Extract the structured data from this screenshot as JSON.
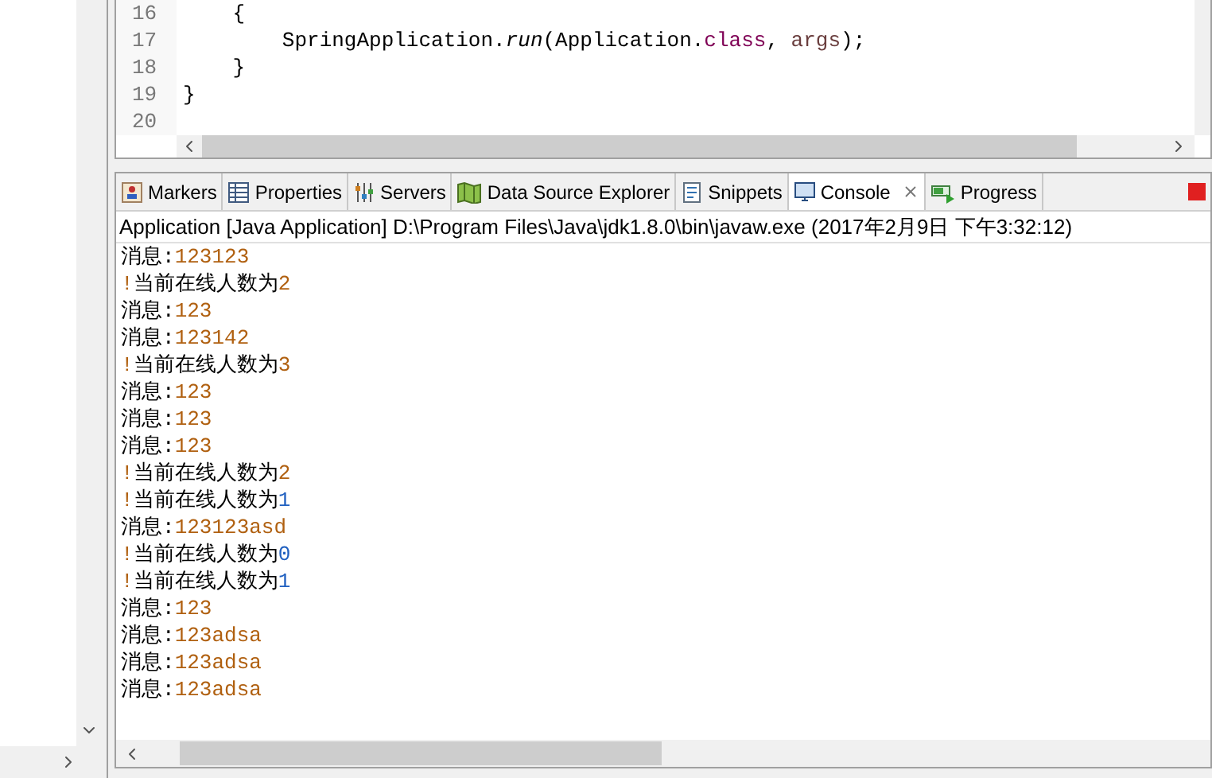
{
  "editor": {
    "lines": [
      {
        "number": "16",
        "parts": [
          {
            "kind": "plain",
            "text": "    {"
          }
        ]
      },
      {
        "number": "17",
        "parts": [
          {
            "kind": "plain",
            "text": "        SpringApplication."
          },
          {
            "kind": "method",
            "text": "run"
          },
          {
            "kind": "plain",
            "text": "(Application."
          },
          {
            "kind": "keyword",
            "text": "class"
          },
          {
            "kind": "plain",
            "text": ", "
          },
          {
            "kind": "variable",
            "text": "args"
          },
          {
            "kind": "plain",
            "text": ");"
          }
        ]
      },
      {
        "number": "18",
        "parts": [
          {
            "kind": "plain",
            "text": "    }"
          }
        ]
      },
      {
        "number": "19",
        "parts": [
          {
            "kind": "plain",
            "text": "}"
          }
        ]
      },
      {
        "number": "20"
      }
    ]
  },
  "tabs": [
    {
      "label": "Markers",
      "selected": false
    },
    {
      "label": "Properties",
      "selected": false
    },
    {
      "label": "Servers",
      "selected": false
    },
    {
      "label": "Data Source Explorer",
      "selected": false
    },
    {
      "label": "Snippets",
      "selected": false
    },
    {
      "label": "Console",
      "selected": true,
      "closable": true
    },
    {
      "label": "Progress",
      "selected": false
    }
  ],
  "console": {
    "title": "Application [Java Application] D:\\Program Files\\Java\\jdk1.8.0\\bin\\javaw.exe (2017年2月9日 下午3:32:12)",
    "lines": [
      [
        {
          "kind": "plain",
          "text": "消息:"
        },
        {
          "kind": "value",
          "text": "123123"
        }
      ],
      [
        {
          "kind": "value",
          "text": "!"
        },
        {
          "kind": "plain",
          "text": "当前在线人数为"
        },
        {
          "kind": "value",
          "text": "2"
        }
      ],
      [
        {
          "kind": "plain",
          "text": "消息:"
        },
        {
          "kind": "value",
          "text": "123"
        }
      ],
      [
        {
          "kind": "plain",
          "text": "消息:"
        },
        {
          "kind": "value",
          "text": "123142"
        }
      ],
      [
        {
          "kind": "value",
          "text": "!"
        },
        {
          "kind": "plain",
          "text": "当前在线人数为"
        },
        {
          "kind": "value",
          "text": "3"
        }
      ],
      [
        {
          "kind": "plain",
          "text": "消息:"
        },
        {
          "kind": "value",
          "text": "123"
        }
      ],
      [
        {
          "kind": "plain",
          "text": "消息:"
        },
        {
          "kind": "value",
          "text": "123"
        }
      ],
      [
        {
          "kind": "plain",
          "text": "消息:"
        },
        {
          "kind": "value",
          "text": "123"
        }
      ],
      [
        {
          "kind": "value",
          "text": "!"
        },
        {
          "kind": "plain",
          "text": "当前在线人数为"
        },
        {
          "kind": "value",
          "text": "2"
        }
      ],
      [
        {
          "kind": "value",
          "text": "!"
        },
        {
          "kind": "plain",
          "text": "当前在线人数为"
        },
        {
          "kind": "number",
          "text": "1"
        }
      ],
      [
        {
          "kind": "plain",
          "text": "消息:"
        },
        {
          "kind": "value",
          "text": "123123asd"
        }
      ],
      [
        {
          "kind": "value",
          "text": "!"
        },
        {
          "kind": "plain",
          "text": "当前在线人数为"
        },
        {
          "kind": "number",
          "text": "0"
        }
      ],
      [
        {
          "kind": "value",
          "text": "!"
        },
        {
          "kind": "plain",
          "text": "当前在线人数为"
        },
        {
          "kind": "number",
          "text": "1"
        }
      ],
      [
        {
          "kind": "plain",
          "text": "消息:"
        },
        {
          "kind": "value",
          "text": "123"
        }
      ],
      [
        {
          "kind": "plain",
          "text": "消息:"
        },
        {
          "kind": "value",
          "text": "123adsa"
        }
      ],
      [
        {
          "kind": "plain",
          "text": "消息:"
        },
        {
          "kind": "value",
          "text": "123adsa"
        }
      ],
      [
        {
          "kind": "plain",
          "text": "消息:"
        },
        {
          "kind": "value",
          "text": "123adsa"
        }
      ]
    ]
  }
}
